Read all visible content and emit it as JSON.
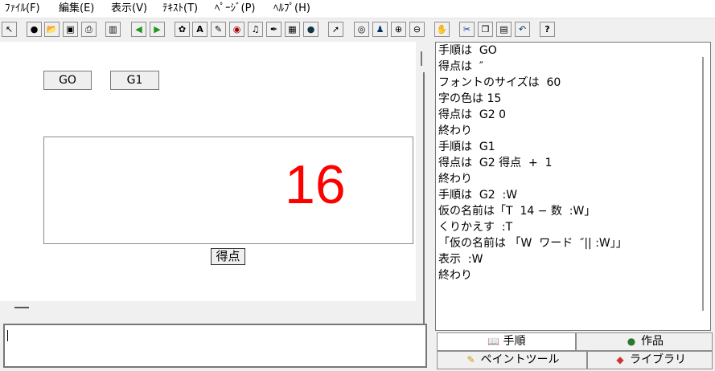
{
  "menu": [
    "ﾌｧｲﾙ(F)",
    "編集(E)",
    "表示(V)",
    "ﾃｷｽﾄ(T)",
    "ﾍﾟｰｼﾞ(P)",
    "ﾍﾙﾌﾟ(H)"
  ],
  "canvas": {
    "button_g0": "GO",
    "button_g1": "G1",
    "score_value": "16",
    "score_button": "得点",
    "score_color": "#ff0000"
  },
  "editor": {
    "lines": [
      "手順は  GO",
      "得点は  ″",
      "フォントのサイズは  60",
      "字の色は 15",
      "得点は  G2 0",
      "終わり",
      "手順は  G1",
      "得点は  G2 得点  +  1",
      "終わり",
      "手順は  G2  :W",
      "仮の名前は「T  14 − 数  :W」",
      "くりかえす  :T",
      "「仮の名前は 「W  ワード  ″|| :W」」",
      "表示  :W",
      "終わり"
    ]
  },
  "tabs": {
    "procedure": "手順",
    "works": "作品",
    "paint_tool": "ペイントツール",
    "library": "ライブラリ"
  },
  "toolbar_icons": [
    "pointer-small-icon",
    "globe-icon",
    "open-folder-icon",
    "save-icon",
    "print-icon",
    "page-layout-icon",
    "arrow-left-icon",
    "arrow-right-icon",
    "turtle-icon",
    "text-a-icon",
    "brush-icon",
    "shape-icon",
    "music-icon",
    "pen-icon",
    "camera-icon",
    "sphere-icon",
    "select-arrow-icon",
    "eye-icon",
    "stamp-icon",
    "zoom-in-icon",
    "zoom-out-icon",
    "stop-hand-icon",
    "scissors-icon",
    "copy-icon",
    "paste-icon",
    "undo-icon",
    "help-icon"
  ]
}
